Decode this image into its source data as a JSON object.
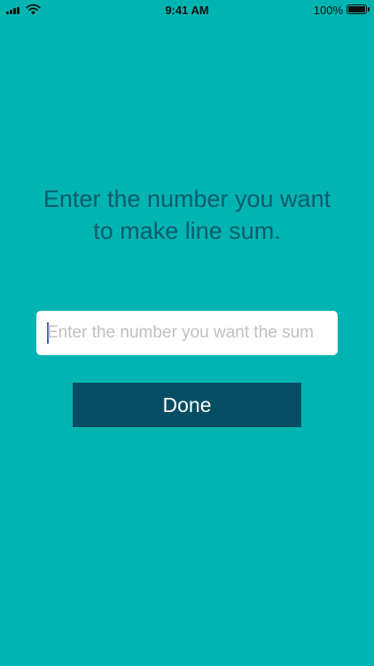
{
  "status_bar": {
    "time": "9:41 AM",
    "battery_percent": "100%",
    "battery_level": 1.0
  },
  "prompt": {
    "line1": "Enter the number you want",
    "line2": "to make line sum."
  },
  "number_input": {
    "value": "",
    "placeholder": "Enter the number you want the sum"
  },
  "done_button": {
    "label": "Done"
  },
  "colors": {
    "background": "#00b4b1",
    "prompt_text": "#0d5c6d",
    "button": "#054d63",
    "caret": "#3b5bdb"
  },
  "icons": {
    "signal": "cellular-signal-icon",
    "wifi": "wifi-icon",
    "battery": "battery-icon"
  }
}
